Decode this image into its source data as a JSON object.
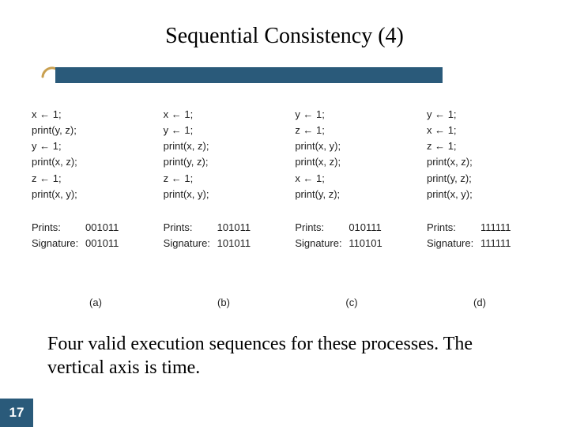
{
  "title": "Sequential Consistency (4)",
  "columns": [
    {
      "ops": [
        "x ← 1;",
        "print(y, z);",
        "y ← 1;",
        "print(x, z);",
        "z ← 1;",
        "print(x, y);"
      ],
      "prints": "001011",
      "signature": "001011",
      "label": "(a)"
    },
    {
      "ops": [
        "x ← 1;",
        "y ← 1;",
        "print(x, z);",
        "print(y, z);",
        "z ← 1;",
        "print(x, y);"
      ],
      "prints": "101011",
      "signature": "101011",
      "label": "(b)"
    },
    {
      "ops": [
        "y ← 1;",
        "z ← 1;",
        "print(x, y);",
        "print(x, z);",
        "x ← 1;",
        "print(y, z);"
      ],
      "prints": "010111",
      "signature": "110101",
      "label": "(c)"
    },
    {
      "ops": [
        "y ← 1;",
        "x ← 1;",
        "z ← 1;",
        "print(x, z);",
        "print(y, z);",
        "print(x, y);"
      ],
      "prints": "111111",
      "signature": "111111",
      "label": "(d)"
    }
  ],
  "summary_labels": {
    "prints": "Prints:",
    "signature": "Signature:"
  },
  "caption": "Four valid execution sequences for these processes. The vertical axis is time.",
  "page_number": "17"
}
